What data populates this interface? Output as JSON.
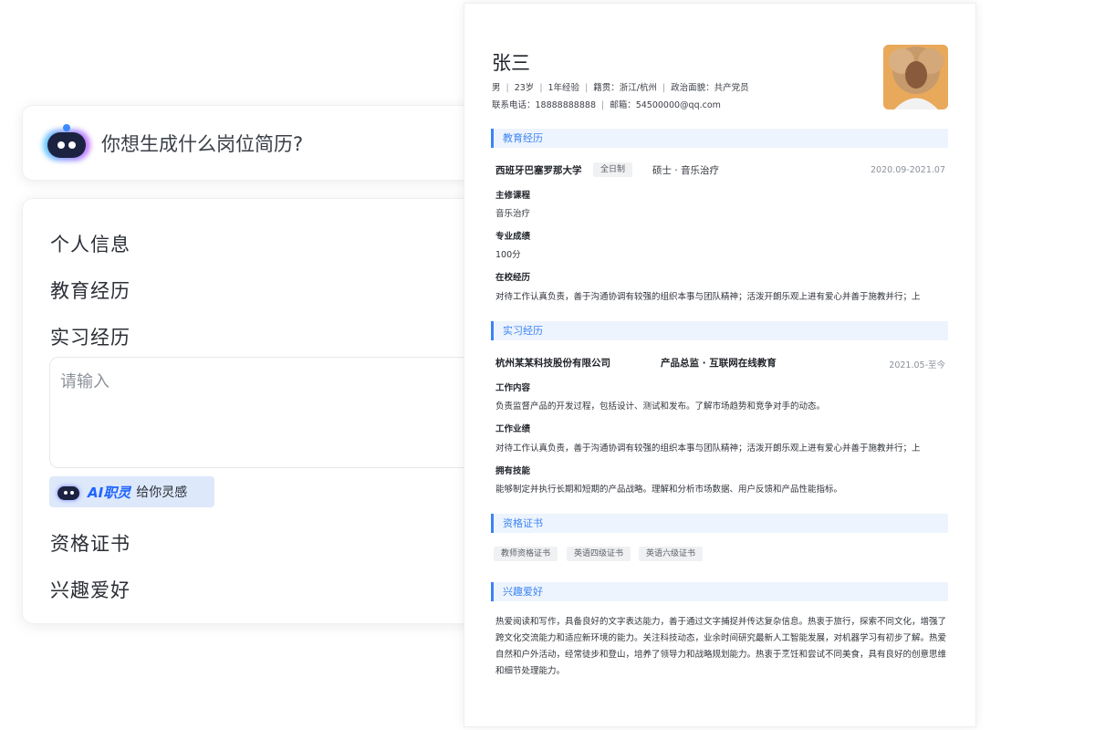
{
  "assistant": {
    "prompt": "你想生成什么岗位简历?"
  },
  "form": {
    "sections": {
      "personal": "个人信息",
      "education": "教育经历",
      "internship": "实习经历",
      "certificates": "资格证书",
      "hobbies": "兴趣爱好"
    },
    "internship_placeholder": "请输入",
    "ai_button": {
      "brand": "AI职灵",
      "tagline": "给你灵感"
    }
  },
  "resume": {
    "name": "张三",
    "meta1": [
      "男",
      "23岁",
      "1年经验",
      "籍贯：浙江/杭州",
      "政治面貌：共产党员"
    ],
    "meta2": [
      "联系电话：18888888888",
      "邮箱：54500000@qq.com"
    ],
    "education": {
      "section_title": "教育经历",
      "school": "西班牙巴塞罗那大学",
      "study_type": "全日制",
      "degree": "硕士 · 音乐治疗",
      "date": "2020.09-2021.07",
      "courses_label": "主修课程",
      "courses": "音乐治疗",
      "grade_label": "专业成绩",
      "grade": "100分",
      "campus_label": "在校经历",
      "campus": "对待工作认真负责，善于沟通协调有较强的组织本事与团队精神；活泼开朗乐观上进有爱心并善于施教并行；上"
    },
    "internship": {
      "section_title": "实习经历",
      "company": "杭州某某科技股份有限公司",
      "position": "产品总监 · 互联网在线教育",
      "date": "2021.05-至今",
      "content_label": "工作内容",
      "content": "负责监督产品的开发过程，包括设计、测试和发布。了解市场趋势和竞争对手的动态。",
      "performance_label": "工作业绩",
      "performance": "对待工作认真负责，善于沟通协调有较强的组织本事与团队精神；活泼开朗乐观上进有爱心并善于施教并行；上",
      "skills_label": "拥有技能",
      "skills": "能够制定并执行长期和短期的产品战略。理解和分析市场数据、用户反馈和产品性能指标。"
    },
    "certificates": {
      "section_title": "资格证书",
      "items": [
        "教师资格证书",
        "英语四级证书",
        "英语六级证书"
      ]
    },
    "hobbies": {
      "section_title": "兴趣爱好",
      "text": "热爱阅读和写作，具备良好的文字表达能力，善于通过文字捕捉并传达复杂信息。热衷于旅行，探索不同文化，增强了跨文化交流能力和适应新环境的能力。关注科技动态，业余时间研究最新人工智能发展，对机器学习有初步了解。热爱自然和户外活动，经常徒步和登山，培养了领导力和战略规划能力。热衷于烹饪和尝试不同美食，具有良好的创意思维和细节处理能力。"
    }
  }
}
